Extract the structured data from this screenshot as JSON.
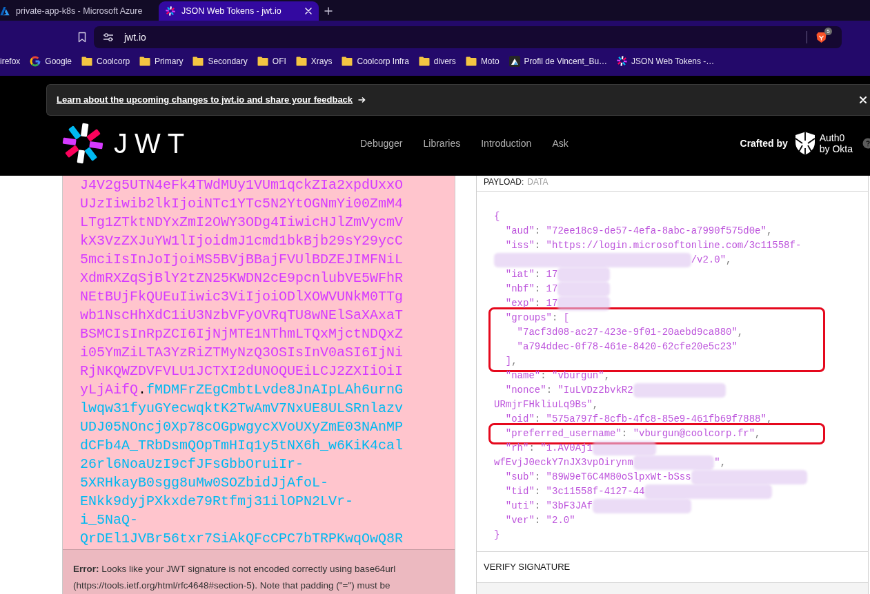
{
  "browser": {
    "tabs": [
      {
        "title": "private-app-k8s - Microsoft Azure",
        "selected": false
      },
      {
        "title": "JSON Web Tokens - jwt.io",
        "selected": true
      }
    ],
    "address": "jwt.io",
    "shield_badge": "5",
    "bookmarks": [
      {
        "label": "irefox",
        "kind": "cut"
      },
      {
        "label": "Google",
        "kind": "ring"
      },
      {
        "label": "Coolcorp",
        "kind": "folder"
      },
      {
        "label": "Primary",
        "kind": "folder"
      },
      {
        "label": "Secondary",
        "kind": "folder"
      },
      {
        "label": "OFI",
        "kind": "folder"
      },
      {
        "label": "Xrays",
        "kind": "folder"
      },
      {
        "label": "Coolcorp Infra",
        "kind": "folder"
      },
      {
        "label": "divers",
        "kind": "folder"
      },
      {
        "label": "Moto",
        "kind": "folder"
      },
      {
        "label": "Profil de Vincent_Bu…",
        "kind": "tile"
      },
      {
        "label": "JSON Web Tokens -…",
        "kind": "pinwheel"
      }
    ]
  },
  "banner": {
    "link": "Learn about the upcoming changes to jwt.io and share your feedback"
  },
  "header": {
    "logo_text": "JWT",
    "nav": [
      "Debugger",
      "Libraries",
      "Introduction",
      "Ask"
    ],
    "crafted_by": "Crafted by",
    "brand_lines": [
      "Auth0",
      "by Okta"
    ]
  },
  "encoded": {
    "payload_lines": [
      "J4V2g5UTN4eFk4TWdMUy1VUm1qckZIa2xpdUxxO",
      "UJzIiwib2lkIjoiNTc1YTc5N2YtOGNmYi00ZmM4",
      "LTg1ZTktNDYxZmI2OWY3ODg4IiwicHJlZmVycmV",
      "kX3VzZXJuYW1lIjoidmJ1cmd1bkBjb29sY29ycC",
      "5mciIsInJoIjoiMS5BVjBBajFVUlBDZEJIMFNiL",
      "XdmRXZqSjBlY2tZN25KWDN2cE9pcnlubVE5WFhR",
      "NEtBUjFkQUEuIiwic3ViIjoiODlXOWVUNkM0TTg",
      "wb1NscHhXdC1iU3NzbVFyOVRqTU8wNElSaXAxaT",
      "BSMCIsInRpZCI6IjNjMTE1NThmLTQxMjctNDQxZ",
      "i05YmZiLTA3YzRiZTMyNzQ3OSIsInV0aSI6IjNi",
      "RjNKQWZDVFVLU1JCTXI2dUNOQUEiLCJ2ZXIiOiI",
      "yLjAifQ"
    ],
    "separator": ".",
    "signature_lines": [
      "fMDMFrZEgCmbtLvde8JnAIpLAh6urnG",
      "lwqw31fyuGYecwqktK2TwAmV7NxUE8ULSRnlazv",
      "UDJ05NOncj0Xp78cOGpwgycXVoUXyZmE03NAnMP",
      "dCFb4A_TRbDsmQOpTmHIq1y5tNX6h_w6KiK4cal",
      "26rl6NoaUzI9cfJFsGbbOruiIr-",
      "5XRHkayB0sgg8uMw0SOZbidJjAfoL-",
      "ENkk9dyjPXkxde79Rtfmj31ilOPN2LVr-",
      "i_5NaQ-",
      "QrDEl1JVBr56txr7SiAkQFcCPC7bTRPKwqOwQ8R"
    ],
    "error": "**Error:** Looks like your JWT signature is not encoded correctly using base64url (https://tools.ietf.org/html/rfc4648#section-5). Note that padding (\"=\") must be"
  },
  "payload": {
    "title": "PAYLOAD:",
    "subtitle": "DATA",
    "lines": [
      {
        "text": "{",
        "redacted": false,
        "highlighted": false
      },
      {
        "text": "  \"aud\": \"72ee18c9-de57-4efa-8abc-a7990f575d0e\",",
        "redacted": false,
        "highlighted": false
      },
      {
        "text": "  \"iss\": \"https://login.microsoftonline.com/3c11558f-",
        "redacted": false,
        "highlighted": false
      },
      {
        "redacted": true,
        "tail": "/v2.0\",",
        "highlighted": false
      },
      {
        "text": "  \"iat\": 17",
        "redacted": true,
        "highlighted": false
      },
      {
        "text": "  \"nbf\": 17",
        "redacted": true,
        "highlighted": false
      },
      {
        "text": "  \"exp\": 17",
        "redacted": true,
        "highlighted": false
      },
      {
        "text": "  \"groups\": [",
        "redacted": false,
        "highlighted": true
      },
      {
        "text": "    \"7acf3d08-ac27-423e-9f01-20aebd9ca880\",",
        "redacted": false,
        "highlighted": true
      },
      {
        "text": "    \"a794ddec-0f78-461e-8420-62cfe20e5c23\"",
        "redacted": false,
        "highlighted": true
      },
      {
        "text": "  ],",
        "redacted": false,
        "highlighted": true
      },
      {
        "text": "  \"name\": \"vburgun\",",
        "redacted": false,
        "highlighted": false
      },
      {
        "text": "  \"nonce\": \"IuLVDz2bvkR2",
        "redacted": true,
        "highlighted": false
      },
      {
        "text": "URmjrFHkliuLq9Bs\",",
        "redacted": false,
        "highlighted": false
      },
      {
        "text": "  \"oid\": \"575a797f-8cfb-4fc8-85e9-461fb69f7888\",",
        "redacted": false,
        "highlighted": false
      },
      {
        "text": "  \"preferred_username\": \"vburgun@coolcorp.fr\",",
        "redacted": false,
        "highlighted": true
      },
      {
        "text": "  \"rh\": \"1.AV0Aj1",
        "redacted": true,
        "highlighted": false
      },
      {
        "text": "wfEvjJ0eckY7nJX3vpOirynm",
        "redacted": true,
        "tail": "\",",
        "highlighted": false
      },
      {
        "text": "  \"sub\": \"89W9eT6C4M80oSlpxWt-bSss",
        "redacted": true,
        "highlighted": false
      },
      {
        "text": "  \"tid\": \"3c11558f-4127-44",
        "redacted": true,
        "highlighted": false
      },
      {
        "text": "  \"uti\": \"3bF3JAf",
        "redacted": true,
        "highlighted": false
      },
      {
        "text": "  \"ver\": \"2.0\"",
        "redacted": false,
        "highlighted": false
      },
      {
        "text": "}",
        "redacted": false,
        "highlighted": false
      }
    ]
  },
  "verify": {
    "title": "VERIFY SIGNATURE"
  }
}
